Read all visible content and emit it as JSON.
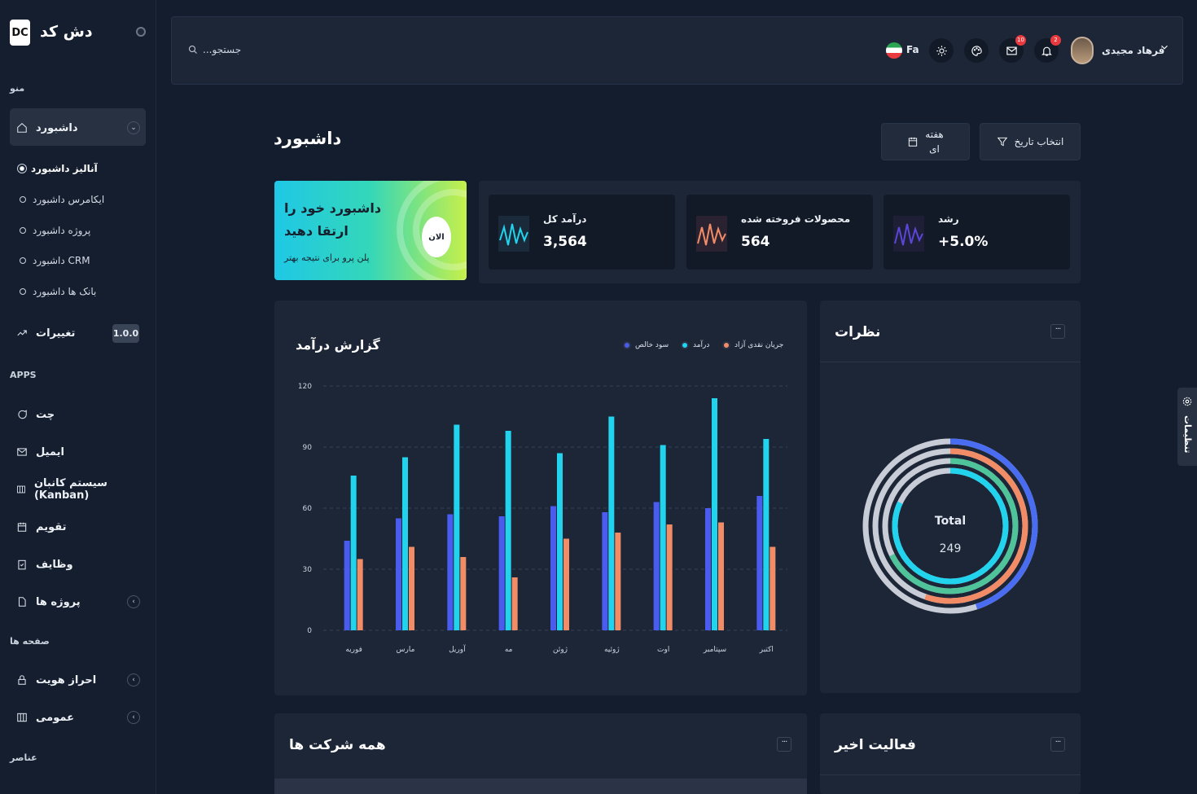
{
  "brand": {
    "logo": "DC",
    "name": "دش کد"
  },
  "sidebar": {
    "menu_label": "منو",
    "dashboard": "داشبورد",
    "subitems": [
      "آنالیز داشبورد",
      "ایکامرس داشبورد",
      "پروژه داشبورد",
      "داشبورد CRM",
      "بانک ها داشبورد"
    ],
    "changelog": "تغییرات",
    "version": "1.0.0",
    "apps_label": "APPS",
    "apps": [
      "چت",
      "ایمیل",
      "سیستم کانبان (Kanban)",
      "تقویم",
      "وظایف",
      "پروژه ها"
    ],
    "pages_label": "صفحه ها",
    "pages": [
      "احراز هویت",
      "عمومی"
    ],
    "elements_label": "عناصر"
  },
  "topbar": {
    "search_placeholder": "...جستجو",
    "lang": "Fa",
    "mail_count": "10",
    "bell_count": "2",
    "user_name": "فرهاد مجیدی"
  },
  "page": {
    "title": "داشبورد",
    "date_button": "انتخاب تاریخ",
    "period_button": "هفته\nای"
  },
  "promo": {
    "title": "داشبورد خود را ارتقا دهید",
    "subtitle": "پلن پرو برای نتیجه بهتر",
    "button": "الان"
  },
  "stats": [
    {
      "label": "درآمد کل",
      "value": "3,564",
      "color": "#22d3ee"
    },
    {
      "label": "محصولات فروخته شده",
      "value": "564",
      "color": "#f28c66"
    },
    {
      "label": "رشد",
      "value": "+5.0%",
      "color": "#5b46d8"
    }
  ],
  "revenue": {
    "title": "گزارش درآمد"
  },
  "chart_data": {
    "type": "bar",
    "categories": [
      "فوریه",
      "مارس",
      "آوریل",
      "مه",
      "ژوئن",
      "ژوئیه",
      "اوت",
      "سپتامبر",
      "اکتبر"
    ],
    "series": [
      {
        "name": "سود خالص",
        "color": "#4a5cf0",
        "values": [
          44,
          55,
          57,
          56,
          61,
          58,
          63,
          60,
          66
        ]
      },
      {
        "name": "درآمد",
        "color": "#22d3ee",
        "values": [
          76,
          85,
          101,
          98,
          87,
          105,
          91,
          114,
          94
        ]
      },
      {
        "name": "جریان نقدی آزاد",
        "color": "#f28c66",
        "values": [
          35,
          41,
          36,
          26,
          45,
          48,
          52,
          53,
          41
        ]
      }
    ],
    "ylim": [
      0,
      120
    ],
    "yticks": [
      0,
      30,
      60,
      90,
      120
    ]
  },
  "comments": {
    "title": "نظرات",
    "total_label": "Total",
    "total_value": "249"
  },
  "companies": {
    "title": "همه شرکت ها"
  },
  "activity": {
    "title": "فعالیت اخیر"
  },
  "settings_tab": "تنظیمات"
}
